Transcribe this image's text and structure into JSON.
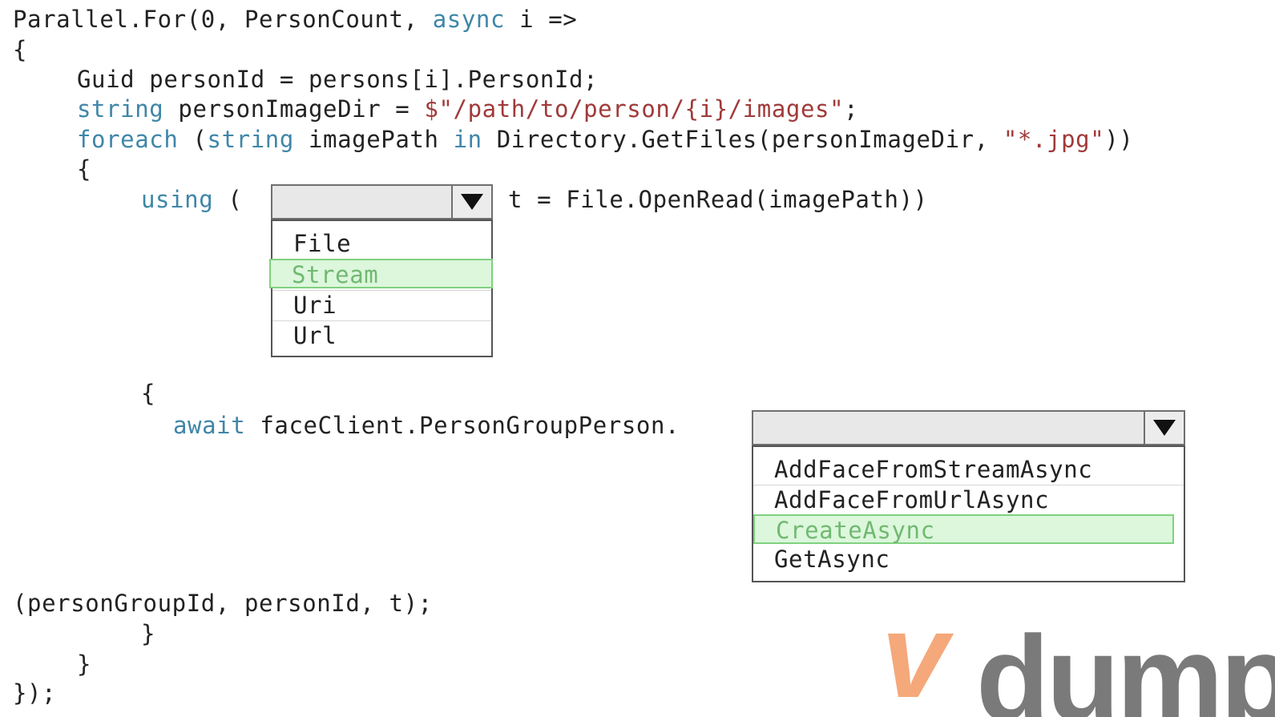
{
  "code": {
    "l1_a": "Parallel.For(0, PersonCount, ",
    "l1_kw": "async",
    "l1_b": " i =>",
    "l2": "{",
    "l3": "Guid personId = persons[i].PersonId;",
    "l4_kw": "string",
    "l4_a": " personImageDir = ",
    "l4_str": "$\"/path/to/person/{i}/images\"",
    "l4_b": ";",
    "l5_kw1": "foreach",
    "l5_a": " (",
    "l5_kw2": "string",
    "l5_b": " imagePath ",
    "l5_kw3": "in",
    "l5_c": " Directory.GetFiles(personImageDir, ",
    "l5_str": "\"*.jpg\"",
    "l5_d": "))",
    "l6": "{",
    "l7_kw": "using",
    "l7_a": " (",
    "l7_b": "t = File.OpenRead(imagePath))",
    "l8": "{",
    "l9_kw": "await",
    "l9_a": " faceClient.PersonGroupPerson.",
    "l10": "(personGroupId, personId, t);",
    "l11": "}",
    "l12": "}",
    "l13": "});"
  },
  "dropdown1": {
    "selected": "",
    "options": [
      "File",
      "Stream",
      "Uri",
      "Url"
    ],
    "highlighted": "Stream"
  },
  "dropdown2": {
    "selected": "",
    "options": [
      "AddFaceFromStreamAsync",
      "AddFaceFromUrlAsync",
      "CreateAsync",
      "GetAsync"
    ],
    "highlighted": "CreateAsync"
  },
  "watermark": {
    "text": "dump",
    "glyph": "v"
  },
  "colors": {
    "keyword": "#3f86a8",
    "string": "#a03a3a",
    "highlight_bg": "#dcf7dc",
    "highlight_text": "#72b872",
    "watermark_orange": "#f5a87a",
    "watermark_gray": "#7a7a7a"
  },
  "icons": {
    "dropdown_arrow": "chevron-down-icon"
  }
}
